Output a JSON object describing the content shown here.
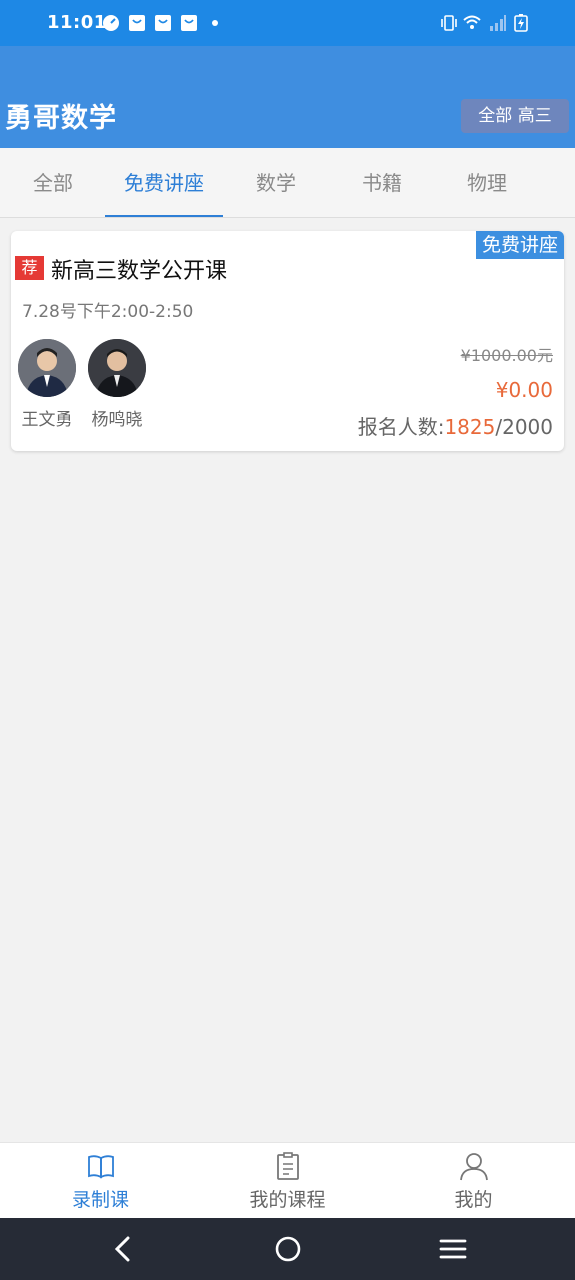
{
  "status_bar": {
    "time": "11:01",
    "icons": [
      "speedometer-icon",
      "shopping-bag-icon",
      "shopping-bag-icon",
      "shopping-bag-icon",
      "dot-icon",
      "vibrate-icon",
      "wifi-icon",
      "signal-icon",
      "battery-charging-icon"
    ]
  },
  "header": {
    "title": "勇哥数学",
    "filter_label": "全部 高三"
  },
  "tabs": [
    {
      "label": "全部",
      "active": false
    },
    {
      "label": "免费讲座",
      "active": true
    },
    {
      "label": "数学",
      "active": false
    },
    {
      "label": "书籍",
      "active": false
    },
    {
      "label": "物理",
      "active": false
    }
  ],
  "course_card": {
    "corner_tag": "免费讲座",
    "badge": "荐",
    "title": "新高三数学公开课",
    "time": "7.28号下午2:00-2:50",
    "teachers": [
      {
        "name": "王文勇"
      },
      {
        "name": "杨鸣晓"
      }
    ],
    "original_price": "¥1000.00元",
    "price": "¥0.00",
    "enroll_label": "报名人数:",
    "enroll_count": "1825",
    "enroll_total": "/2000"
  },
  "bottom_nav": [
    {
      "label": "录制课",
      "icon": "book-icon",
      "active": true
    },
    {
      "label": "我的课程",
      "icon": "clipboard-icon",
      "active": false
    },
    {
      "label": "我的",
      "icon": "person-icon",
      "active": false
    }
  ],
  "system_nav": {
    "icons": [
      "back-icon",
      "home-icon",
      "menu-icon"
    ]
  },
  "colors": {
    "status_bar": "#1e88e5",
    "header": "#3f8ee0",
    "accent": "#2e7fd6",
    "price": "#e8693a",
    "badge": "#e53935"
  }
}
